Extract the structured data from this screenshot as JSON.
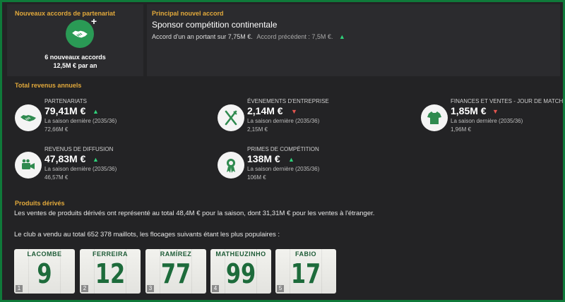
{
  "partnerships": {
    "title": "Nouveaux accords de partenariat",
    "count_text": "6 nouveaux accords",
    "per_year_text": "12,5M € par an",
    "icon": "handshake-plus-icon"
  },
  "main_deal": {
    "title": "Principal nouvel accord",
    "name": "Sponsor compétition continentale",
    "description": "Accord d'un an portant sur 7,75M €.",
    "previous": "Accord précédent : 7,5M €.",
    "trend": "up"
  },
  "revenue": {
    "title": "Total revenus annuels",
    "items": [
      {
        "label": "PARTENARIATS",
        "value": "79,41M €",
        "trend": "up",
        "last_season": "La saison dernière (2035/36)",
        "last_value": "72,66M €",
        "icon": "handshake-icon"
      },
      {
        "label": "ÉVENEMENTS D'ENTREPRISE",
        "value": "2,14M €",
        "trend": "down",
        "last_season": "La saison dernière (2035/36)",
        "last_value": "2,15M €",
        "icon": "cutlery-icon"
      },
      {
        "label": "FINANCES ET VENTES - JOUR DE MATCH",
        "value": "1,85M €",
        "trend": "down",
        "last_season": "La saison dernière (2035/36)",
        "last_value": "1,96M €",
        "icon": "shirt-icon"
      },
      {
        "label": "REVENUS DE DIFFUSION",
        "value": "47,83M €",
        "trend": "up",
        "last_season": "La saison dernière (2035/36)",
        "last_value": "46,57M €",
        "icon": "camera-icon"
      },
      {
        "label": "PRIMES DE COMPÉTITION",
        "value": "138M €",
        "trend": "up",
        "last_season": "La saison dernière (2035/36)",
        "last_value": "106M €",
        "icon": "rosette-icon"
      }
    ]
  },
  "merch": {
    "title": "Produits dérivés",
    "sales_text": "Les ventes de produits dérivés ont représenté au total 48,4M € pour la saison, dont 31,31M € pour les ventes à l'étranger.",
    "shirts_text": "Le club a vendu au total 652 378 maillots, les flocages suivants étant les plus populaires :",
    "shirts": [
      {
        "rank": "1",
        "name": "LACOMBE",
        "number": "9"
      },
      {
        "rank": "2",
        "name": "FERREIRA",
        "number": "12"
      },
      {
        "rank": "3",
        "name": "RAMÍREZ",
        "number": "77"
      },
      {
        "rank": "4",
        "name": "MATHEUZINHO",
        "number": "99"
      },
      {
        "rank": "5",
        "name": "FABIO",
        "number": "17"
      }
    ]
  },
  "colors": {
    "accent": "#e2a93b",
    "up": "#2fd27a",
    "down": "#e5554f",
    "brand_green": "#0f7a3a",
    "shirt_text": "#1d6b3b"
  }
}
